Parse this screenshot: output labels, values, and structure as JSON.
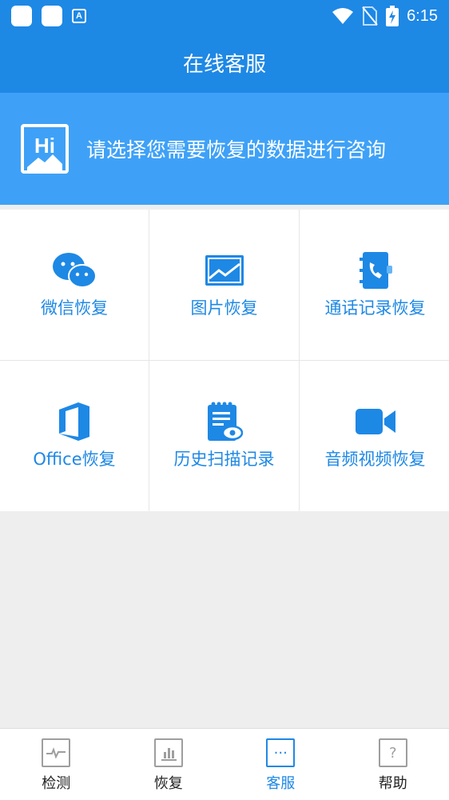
{
  "status_bar": {
    "time": "6:15",
    "a_label": "A"
  },
  "app_bar": {
    "title": "在线客服"
  },
  "banner": {
    "icon_text": "Hi",
    "text": "请选择您需要恢复的数据进行咨询"
  },
  "grid": {
    "items": [
      {
        "label": "微信恢复",
        "icon": "wechat-icon"
      },
      {
        "label": "图片恢复",
        "icon": "image-icon"
      },
      {
        "label": "通话记录恢复",
        "icon": "phone-book-icon"
      },
      {
        "label": "Office恢复",
        "icon": "office-icon"
      },
      {
        "label": "历史扫描记录",
        "icon": "history-scan-icon"
      },
      {
        "label": "音频视频恢复",
        "icon": "video-camera-icon"
      }
    ]
  },
  "bottom_nav": {
    "items": [
      {
        "label": "检测",
        "icon": "pulse-icon",
        "active": false
      },
      {
        "label": "恢复",
        "icon": "bar-chart-icon",
        "active": false
      },
      {
        "label": "客服",
        "icon": "chat-dots-icon",
        "active": true,
        "glyph": "···"
      },
      {
        "label": "帮助",
        "icon": "help-icon",
        "active": false,
        "glyph": "?"
      }
    ]
  },
  "colors": {
    "primary": "#1e88e5",
    "banner": "#3ea1f7",
    "background": "#eeeeee"
  }
}
